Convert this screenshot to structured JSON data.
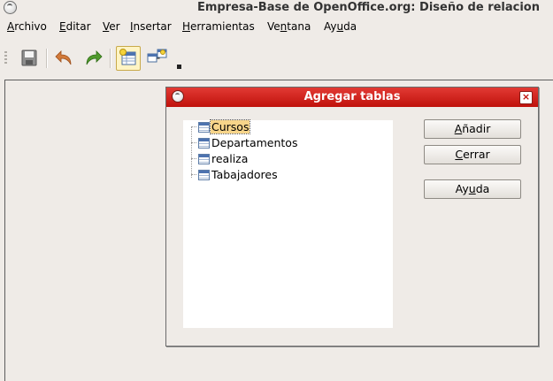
{
  "window": {
    "title": "Empresa-Base de OpenOffice.org: Diseño de relacion"
  },
  "menubar": {
    "items": [
      {
        "pre": "",
        "acc": "A",
        "post": "rchivo"
      },
      {
        "pre": "",
        "acc": "E",
        "post": "ditar"
      },
      {
        "pre": "",
        "acc": "V",
        "post": "er"
      },
      {
        "pre": "",
        "acc": "I",
        "post": "nsertar"
      },
      {
        "pre": "",
        "acc": "H",
        "post": "erramientas"
      },
      {
        "pre": "Ve",
        "acc": "n",
        "post": "tana"
      },
      {
        "pre": "Ay",
        "acc": "u",
        "post": "da"
      }
    ]
  },
  "toolbar": {
    "buttons": [
      "save-icon",
      "undo-icon",
      "redo-icon",
      "add-tables-icon",
      "new-relation-icon"
    ],
    "colors": {
      "undo": "#d27a3a",
      "redo": "#4f9a2c"
    }
  },
  "dialog": {
    "title": "Agregar tablas",
    "close_glyph": "×",
    "tables": [
      {
        "name": "Cursos",
        "selected": true
      },
      {
        "name": "Departamentos",
        "selected": false
      },
      {
        "name": "realiza",
        "selected": false
      },
      {
        "name": "Tabajadores",
        "selected": false
      }
    ],
    "buttons": {
      "add": {
        "pre": "",
        "acc": "A",
        "post": "ñadir"
      },
      "close": {
        "pre": "",
        "acc": "C",
        "post": "errar"
      },
      "help": {
        "pre": "Ay",
        "acc": "u",
        "post": "da"
      }
    }
  },
  "colors": {
    "dialog_title": "#d62a24",
    "selection": "#f7d58a",
    "background": "#efebe7"
  }
}
